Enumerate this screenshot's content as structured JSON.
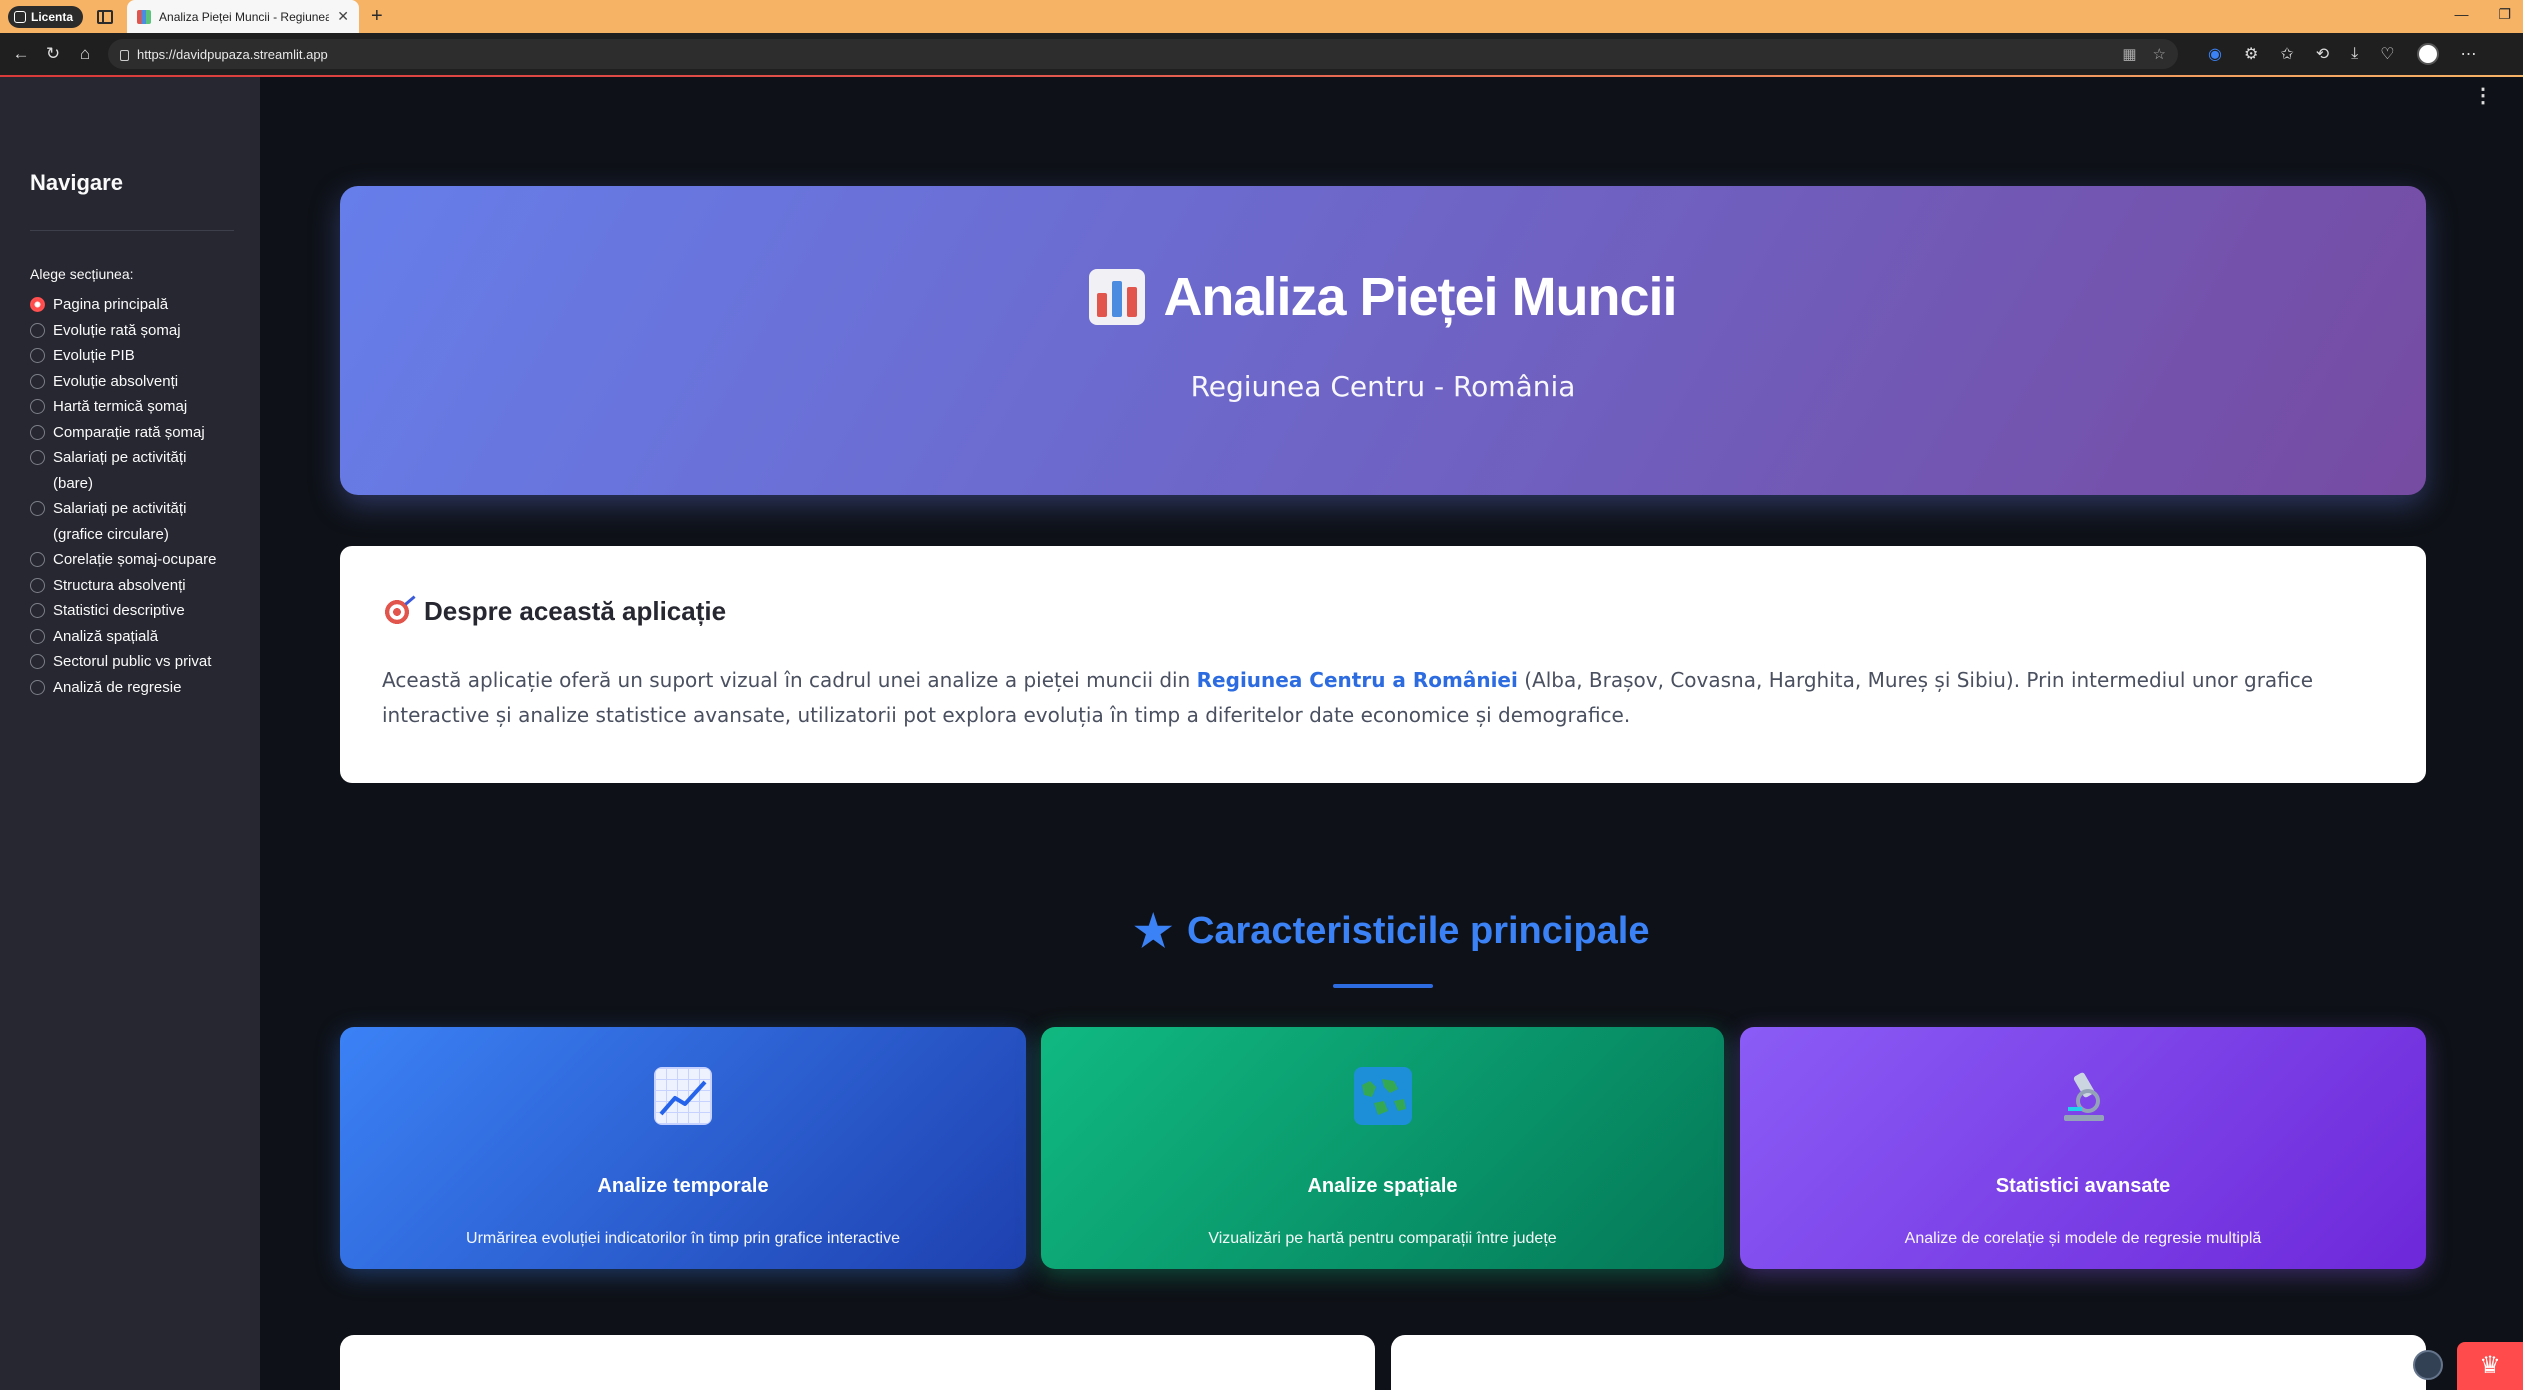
{
  "browser": {
    "profile_label": "Licenta",
    "tab_title": "Analiza Pieței Muncii - Regiunea Centru",
    "url": "https://davidpupaza.streamlit.app"
  },
  "sidebar": {
    "title": "Navigare",
    "section_label": "Alege secțiunea:",
    "items": [
      {
        "label": "Pagina principală",
        "selected": true
      },
      {
        "label": "Evoluție rată șomaj",
        "selected": false
      },
      {
        "label": "Evoluție PIB",
        "selected": false
      },
      {
        "label": "Evoluție absolvenți",
        "selected": false
      },
      {
        "label": "Hartă termică șomaj",
        "selected": false
      },
      {
        "label": "Comparație rată șomaj",
        "selected": false
      },
      {
        "label": "Salariați pe activități (bare)",
        "selected": false
      },
      {
        "label": "Salariați pe activități (grafice circulare)",
        "selected": false
      },
      {
        "label": "Corelație șomaj-ocupare",
        "selected": false
      },
      {
        "label": "Structura absolvenți",
        "selected": false
      },
      {
        "label": "Statistici descriptive",
        "selected": false
      },
      {
        "label": "Analiză spațială",
        "selected": false
      },
      {
        "label": "Sectorul public vs privat",
        "selected": false
      },
      {
        "label": "Analiză de regresie",
        "selected": false
      }
    ]
  },
  "hero": {
    "title": "Analiza Pieței Muncii",
    "subtitle": "Regiunea Centru - România"
  },
  "about": {
    "title": "Despre această aplicație",
    "text_before": "Această aplicație oferă un suport vizual în cadrul unei analize a pieței muncii din ",
    "highlight": "Regiunea Centru a României",
    "text_after": " (Alba, Brașov, Covasna, Harghita, Mureș și Sibiu). Prin intermediul unor grafice interactive și analize statistice avansate, utilizatorii pot explora evoluția în timp a diferitelor date economice și demografice."
  },
  "features": {
    "title": "Caracteristicile principale",
    "cards": [
      {
        "icon": "chart-increasing-icon",
        "title": "Analize temporale",
        "desc": "Urmărirea evoluției indicatorilor în timp prin grafice interactive"
      },
      {
        "icon": "world-map-icon",
        "title": "Analize spațiale",
        "desc": "Vizualizări pe hartă pentru comparații între județe"
      },
      {
        "icon": "microscope-icon",
        "title": "Statistici avansate",
        "desc": "Analize de corelație și modele de regresie multiplă"
      }
    ]
  },
  "colors": {
    "accent": "#ff4b4b",
    "hero_start": "#667eea",
    "hero_end": "#764ba2",
    "link": "#2d6ce0"
  }
}
